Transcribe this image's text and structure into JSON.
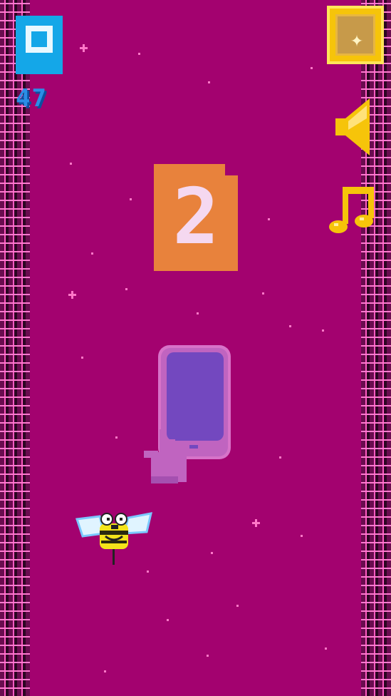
{
  "game": {
    "best_score": "47",
    "countdown": "2"
  },
  "icons": {
    "best_icon": "best-score-square-icon",
    "shop": "sparkle-shop-icon",
    "sound": "speaker-icon",
    "music": "music-note-icon",
    "hint": "tap-phone-hint-icon",
    "player": "bee-character-icon"
  },
  "colors": {
    "background": "#a3026f",
    "wall_stripe": "#ff5ac2",
    "best_blue": "#14a7e8",
    "countdown_orange": "#e8823c",
    "gold": "#f6c40a",
    "hint_purple": "#7a4bc4"
  }
}
